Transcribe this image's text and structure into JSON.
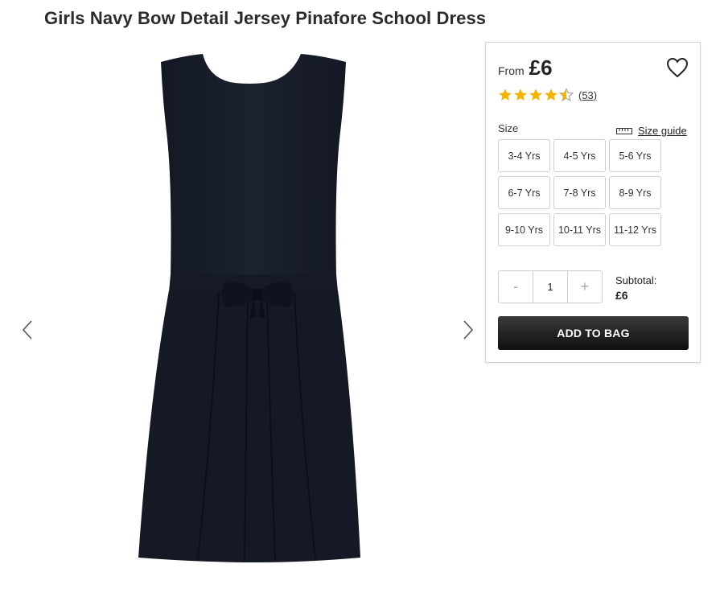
{
  "product": {
    "title": "Girls Navy Bow Detail Jersey Pinafore School Dress",
    "image_alt": "Navy pinafore dress with bow at waist"
  },
  "gallery": {
    "prev_icon": "chevron-left-icon",
    "next_icon": "chevron-right-icon"
  },
  "price": {
    "from_label": "From",
    "value": "£6"
  },
  "rating": {
    "stars": 4.5,
    "max": 5,
    "count_label": "(53)",
    "star_color": "#f5b400"
  },
  "size": {
    "label": "Size",
    "guide_label": "Size guide",
    "options": [
      "3-4 Yrs",
      "4-5 Yrs",
      "5-6 Yrs",
      "6-7 Yrs",
      "7-8 Yrs",
      "8-9 Yrs",
      "9-10 Yrs",
      "10-11 Yrs",
      "11-12 Yrs"
    ]
  },
  "quantity": {
    "minus": "-",
    "value": "1",
    "plus": "+"
  },
  "subtotal": {
    "label": "Subtotal:",
    "value": "£6"
  },
  "cta": {
    "add_to_bag": "ADD TO BAG"
  }
}
